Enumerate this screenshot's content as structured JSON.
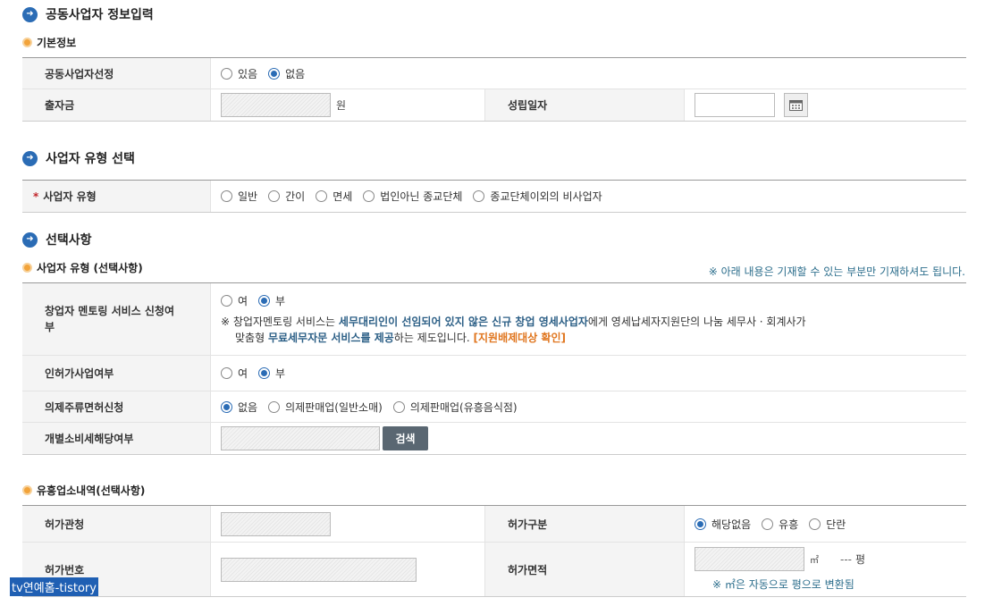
{
  "sections": {
    "partner_title": "공동사업자 정보입력",
    "basic_info": "기본정보",
    "biz_type_title": "사업자 유형 선택",
    "optional_title": "선택사항",
    "biz_type_optional": "사업자 유형 (선택사항)",
    "entertainment": "유흥업소내역(선택사항)"
  },
  "basic": {
    "partner_select_label": "공동사업자선정",
    "partner_select_options": [
      "있음",
      "없음"
    ],
    "partner_select_value": "없음",
    "capital_label": "출자금",
    "capital_unit": "원",
    "founding_date_label": "성립일자"
  },
  "biz_type": {
    "required_mark": "*",
    "label": "사업자 유형",
    "options": [
      "일반",
      "간이",
      "면세",
      "법인아닌 종교단체",
      "종교단체이외의 비사업자"
    ]
  },
  "optional": {
    "notice": "※ 아래 내용은 기재할 수 있는 부분만 기재하셔도 됩니다.",
    "mentoring_label": "창업자 멘토링 서비스 신청여부",
    "mentoring_options": [
      "여",
      "부"
    ],
    "mentoring_value": "부",
    "mentoring_note_prefix": "※ 창업자멘토링 서비스는 ",
    "mentoring_note_bold1": "세무대리인이 선임되어 있지 않은 신규 창업 영세사업자",
    "mentoring_note_mid": "에게 영세납세자지원단의 나눔 세무사 · 회계사가",
    "mentoring_note_line2_prefix": "맞춤형 ",
    "mentoring_note_bold2": "무료세무자문 서비스를 제공",
    "mentoring_note_suffix": "하는 제도입니다. ",
    "mentoring_note_link": "[지원배제대상 확인]",
    "permit_label": "인허가사업여부",
    "permit_options": [
      "여",
      "부"
    ],
    "permit_value": "부",
    "liquor_label": "의제주류면허신청",
    "liquor_options": [
      "없음",
      "의제판매업(일반소매)",
      "의제판매업(유흥음식점)"
    ],
    "liquor_value": "없음",
    "consumption_tax_label": "개별소비세해당여부",
    "search_button": "검색"
  },
  "entertainment": {
    "permit_office_label": "허가관청",
    "permit_type_label": "허가구분",
    "permit_type_options": [
      "해당없음",
      "유흥",
      "단란"
    ],
    "permit_type_value": "해당없음",
    "permit_no_label": "허가번호",
    "permit_area_label": "허가면적",
    "area_unit": "㎡",
    "pyeong_value": "---",
    "pyeong_unit": "평",
    "area_note": "※ ㎡은 자동으로 평으로 변환됨"
  },
  "watermark": "tv연예홈-tistory"
}
